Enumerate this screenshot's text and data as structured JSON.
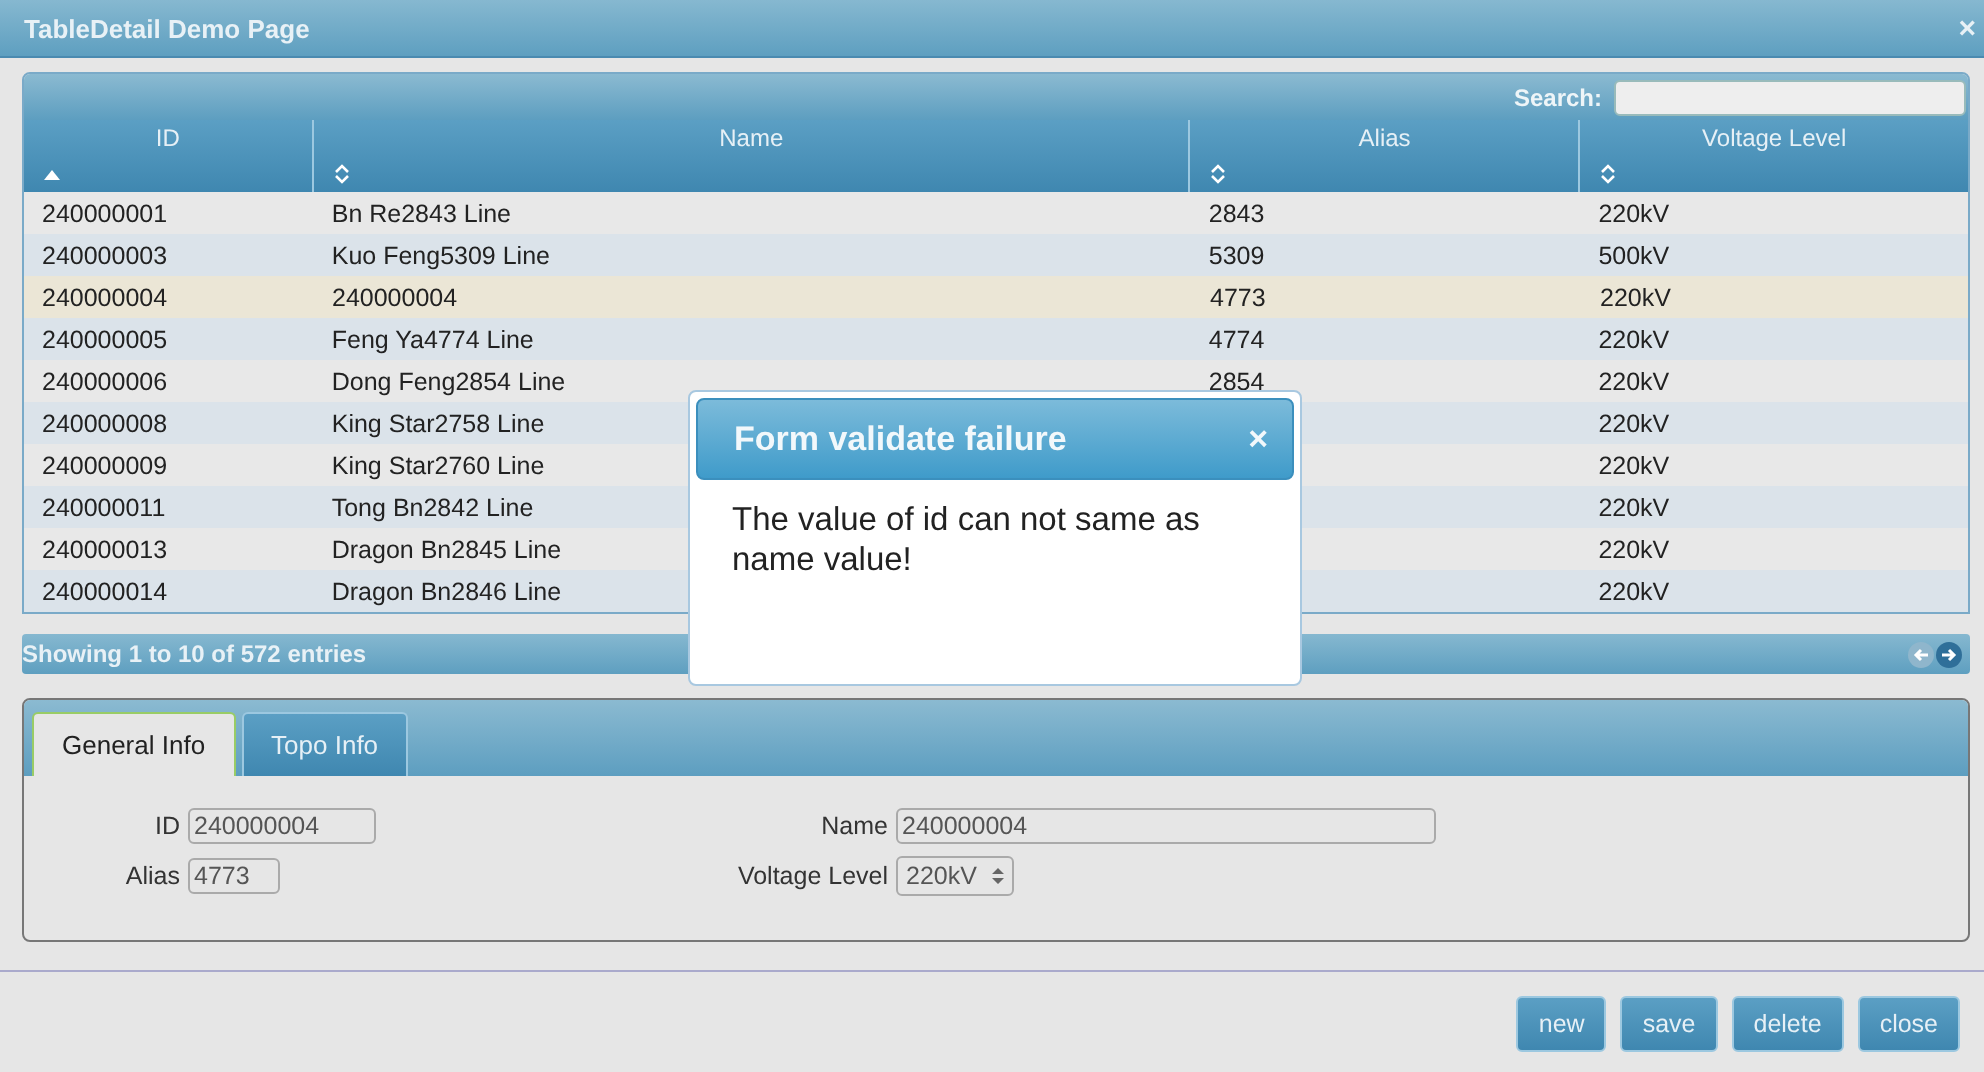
{
  "window": {
    "title": "TableDetail Demo Page",
    "close": "×"
  },
  "table": {
    "search_label": "Search:",
    "columns": [
      {
        "label": "ID",
        "sorted": true
      },
      {
        "label": "Name",
        "sorted": false
      },
      {
        "label": "Alias",
        "sorted": false
      },
      {
        "label": "Voltage Level",
        "sorted": false
      }
    ],
    "rows": [
      {
        "cells": [
          "240000001",
          "Bn Re2843 Line",
          "2843",
          "220kV"
        ],
        "selected": false
      },
      {
        "cells": [
          "240000003",
          "Kuo Feng5309 Line",
          "5309",
          "500kV"
        ],
        "selected": false
      },
      {
        "cells": [
          "240000004",
          "240000004",
          "4773",
          "220kV"
        ],
        "selected": true
      },
      {
        "cells": [
          "240000005",
          "Feng Ya4774 Line",
          "4774",
          "220kV"
        ],
        "selected": false
      },
      {
        "cells": [
          "240000006",
          "Dong Feng2854 Line",
          "2854",
          "220kV"
        ],
        "selected": false
      },
      {
        "cells": [
          "240000008",
          "King Star2758 Line",
          null,
          "220kV"
        ],
        "selected": false
      },
      {
        "cells": [
          "240000009",
          "King Star2760 Line",
          null,
          "220kV"
        ],
        "selected": false
      },
      {
        "cells": [
          "240000011",
          "Tong Bn2842 Line",
          null,
          "220kV"
        ],
        "selected": false
      },
      {
        "cells": [
          "240000013",
          "Dragon Bn2845 Line",
          null,
          "220kV"
        ],
        "selected": false
      },
      {
        "cells": [
          "240000014",
          "Dragon Bn2846 Line",
          null,
          "220kV"
        ],
        "selected": false
      }
    ],
    "info": "Showing 1 to 10 of 572 entries",
    "prev_disabled": true,
    "next_disabled": false
  },
  "tabs": [
    {
      "label": "General Info",
      "selected": true
    },
    {
      "label": "Topo Info",
      "selected": false
    }
  ],
  "form": {
    "id_label": "ID",
    "id_value": "240000004",
    "name_label": "Name",
    "name_value": "240000004",
    "alias_label": "Alias",
    "alias_value": "4773",
    "voltage_label": "Voltage Level",
    "voltage_value": "220kV"
  },
  "buttons": [
    "new",
    "save",
    "delete",
    "close"
  ],
  "dialog": {
    "title": "Form validate failure",
    "close": "×",
    "message": "The value of id can not same as name value!"
  }
}
